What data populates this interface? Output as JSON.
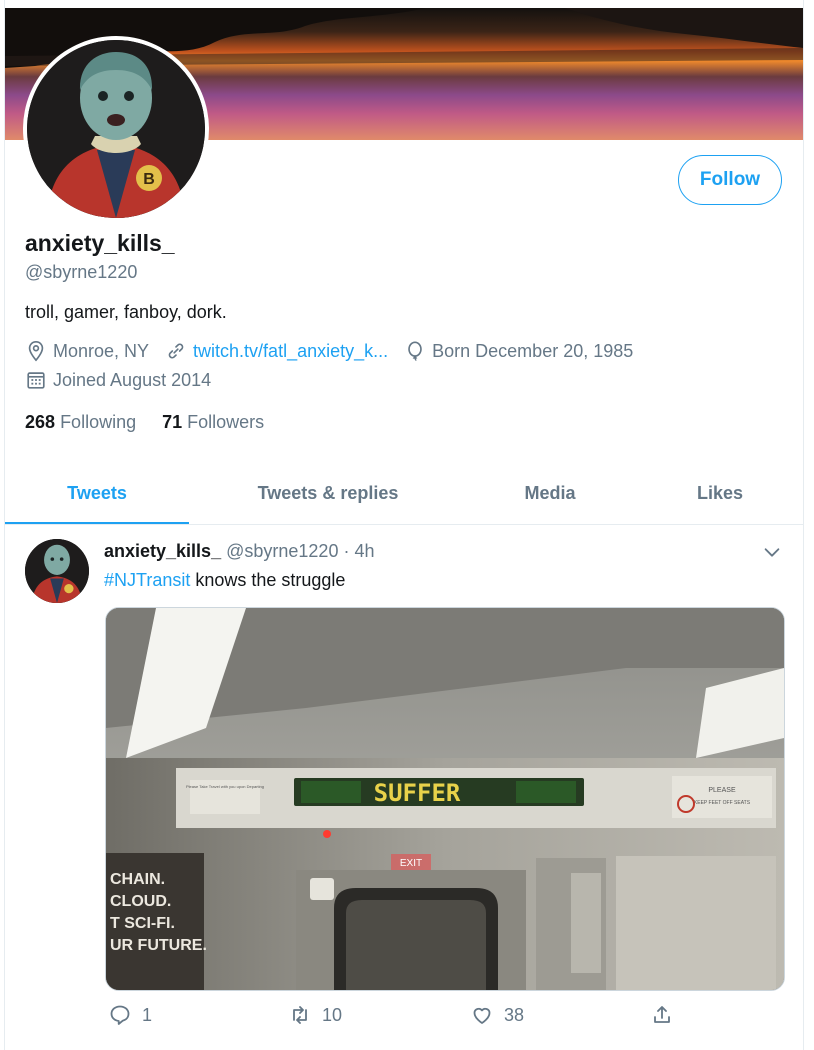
{
  "profile": {
    "display_name": "anxiety_kills_",
    "handle": "@sbyrne1220",
    "bio": "troll, gamer, fanboy, dork.",
    "location": "Monroe, NY",
    "website": "twitch.tv/fatl_anxiety_k...",
    "birthday": "Born December 20, 1985",
    "joined": "Joined August 2014",
    "follow_label": "Follow",
    "following_count": "268",
    "following_label": "Following",
    "followers_count": "71",
    "followers_label": "Followers",
    "avatar_badge_letter": "B"
  },
  "tabs": [
    {
      "label": "Tweets",
      "active": true
    },
    {
      "label": "Tweets & replies",
      "active": false
    },
    {
      "label": "Media",
      "active": false
    },
    {
      "label": "Likes",
      "active": false
    }
  ],
  "tweet": {
    "name": "anxiety_kills_",
    "handle": "@sbyrne1220",
    "separator": "·",
    "time": "4h",
    "hashtag": "#NJTransit",
    "text": " knows the struggle",
    "image": {
      "sign_text": "SUFFER",
      "exit_text": "EXIT",
      "poster_lines": [
        "CHAIN.",
        "CLOUD.",
        "T SCI-FI.",
        "UR FUTURE."
      ],
      "left_placard": "Please Take Travel with you upon Departing",
      "right_placard_title": "PLEASE",
      "right_placard_text": "KEEP FEET OFF SEATS"
    },
    "replies": "1",
    "retweets": "10",
    "likes": "38"
  },
  "colors": {
    "accent": "#1da1f2",
    "secondary_text": "#657786",
    "primary_text": "#14171a",
    "border": "#e6ecf0",
    "sign_led": "#e8d24a"
  },
  "icons": [
    "location-icon",
    "link-icon",
    "balloon-icon",
    "calendar-icon",
    "chevron-down-icon",
    "reply-icon",
    "retweet-icon",
    "like-icon",
    "share-icon"
  ]
}
